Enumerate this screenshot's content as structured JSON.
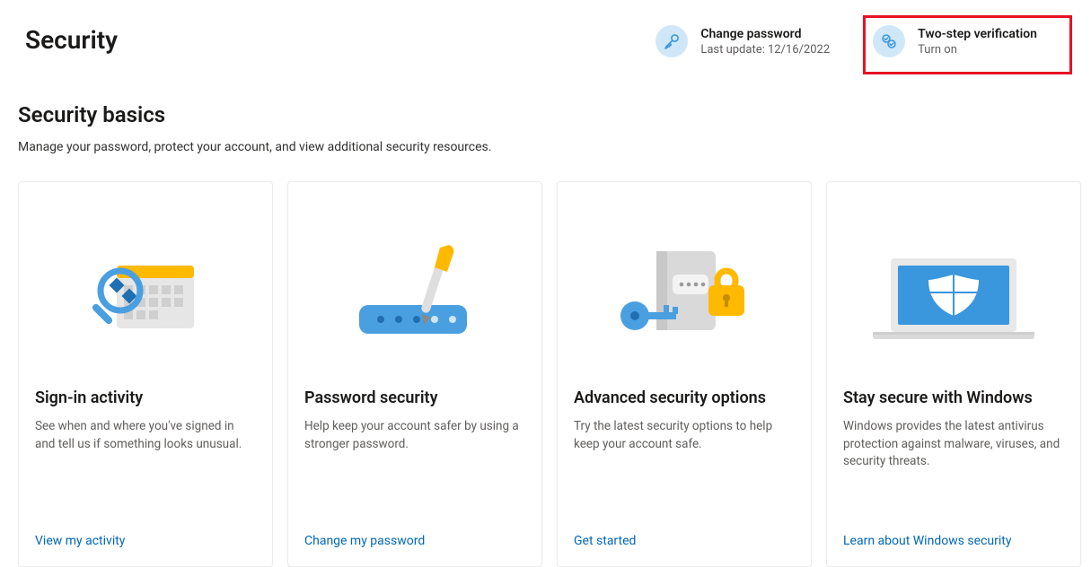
{
  "header": {
    "title": "Security",
    "actions": [
      {
        "label": "Change password",
        "sub": "Last update: 12/16/2022",
        "icon": "key-icon"
      },
      {
        "label": "Two-step verification",
        "sub": "Turn on",
        "icon": "two-step-icon",
        "highlighted": true
      }
    ]
  },
  "section": {
    "title": "Security basics",
    "subtitle": "Manage your password, protect your account, and view additional security resources."
  },
  "cards": [
    {
      "title": "Sign-in activity",
      "desc": "See when and where you've signed in and tell us if something looks unusual.",
      "link": "View my activity"
    },
    {
      "title": "Password security",
      "desc": "Help keep your account safer by using a stronger password.",
      "link": "Change my password"
    },
    {
      "title": "Advanced security options",
      "desc": "Try the latest security options to help keep your account safe.",
      "link": "Get started"
    },
    {
      "title": "Stay secure with Windows",
      "desc": "Windows provides the latest antivirus protection against malware, viruses, and security threats.",
      "link": "Learn about Windows security"
    }
  ],
  "colors": {
    "accent": "#0067b8",
    "highlight_border": "#e81123",
    "icon_bg": "#d0e7f8",
    "brand_blue": "#3a96dd",
    "brand_yellow": "#ffb900"
  }
}
